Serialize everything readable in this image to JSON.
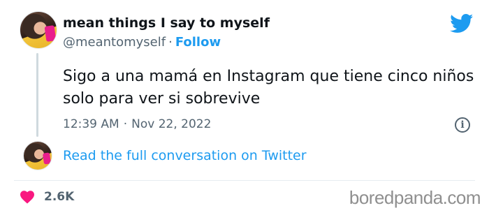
{
  "author": {
    "display_name": "mean things I say to myself",
    "handle": "@meantomyself",
    "separator": "·",
    "follow_label": "Follow"
  },
  "tweet": {
    "text": "Sigo a una mamá en Instagram que tiene cinco niños solo para ver si sobrevive",
    "time": "12:39 AM",
    "date_separator": "·",
    "date": "Nov 22, 2022",
    "info_icon": "info-icon"
  },
  "conversation": {
    "read_link_label": "Read the full conversation on Twitter"
  },
  "engagement": {
    "likes": "2.6K",
    "like_icon": "heart-icon"
  },
  "watermark": "boredpanda.com",
  "colors": {
    "brand_blue": "#1d9bf0",
    "text_primary": "#0f1419",
    "text_secondary": "#536471",
    "heart": "#f91880"
  }
}
